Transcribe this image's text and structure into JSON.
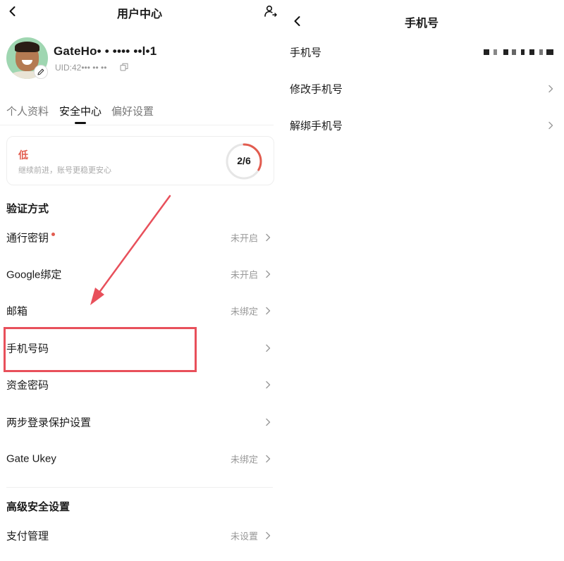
{
  "left": {
    "header": {
      "title": "用户中心"
    },
    "profile": {
      "username": "GateHo• • •••• ••l•1",
      "uid": "UID:42••• •• ••"
    },
    "tabs": [
      {
        "label": "个人资料",
        "active": false
      },
      {
        "label": "安全中心",
        "active": true
      },
      {
        "label": "偏好设置",
        "active": false
      }
    ],
    "security_level": {
      "level": "低",
      "hint": "继续前进，账号更稳更安心",
      "progress_label": "2/6",
      "progress": 0.333,
      "accent_color": "#e25c4f"
    },
    "verification": {
      "title": "验证方式",
      "items": [
        {
          "label": "通行密钥",
          "status": "未开启",
          "dot": true
        },
        {
          "label": "Google绑定",
          "status": "未开启"
        },
        {
          "label": "邮箱",
          "status": "未绑定"
        },
        {
          "label": "手机号码",
          "status": ""
        },
        {
          "label": "资金密码",
          "status": ""
        },
        {
          "label": "两步登录保护设置",
          "status": ""
        },
        {
          "label": "Gate Ukey",
          "status": "未绑定"
        }
      ]
    },
    "advanced": {
      "title": "高级安全设置",
      "items": [
        {
          "label": "支付管理",
          "status": "未设置"
        }
      ]
    }
  },
  "right": {
    "header": {
      "title": "手机号"
    },
    "items": [
      {
        "label": "手机号",
        "value_masked": true
      },
      {
        "label": "修改手机号"
      },
      {
        "label": "解绑手机号"
      }
    ]
  },
  "annotation": {
    "color": "#e8505b"
  }
}
